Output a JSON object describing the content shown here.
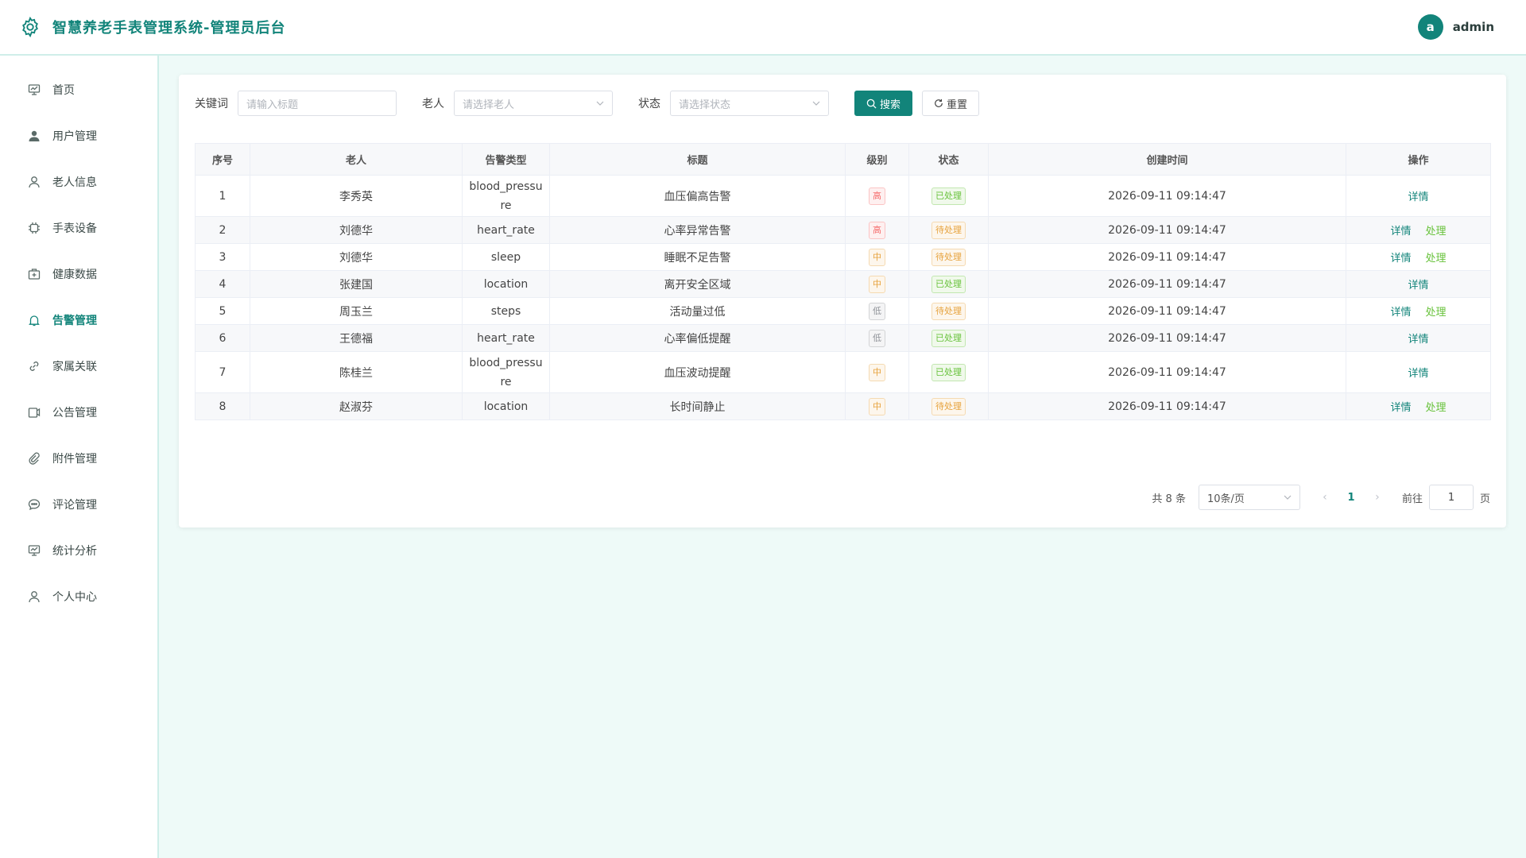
{
  "header": {
    "title": "智慧养老手表管理系统-管理员后台",
    "user": {
      "avatar_letter": "a",
      "name": "admin"
    }
  },
  "sidebar": {
    "items": [
      {
        "label": "首页",
        "icon": "dashboard-icon"
      },
      {
        "label": "用户管理",
        "icon": "user-filled-icon"
      },
      {
        "label": "老人信息",
        "icon": "user-icon"
      },
      {
        "label": "手表设备",
        "icon": "chip-icon"
      },
      {
        "label": "健康数据",
        "icon": "medical-box-icon"
      },
      {
        "label": "告警管理",
        "icon": "bell-icon",
        "active": true
      },
      {
        "label": "家属关联",
        "icon": "link-icon"
      },
      {
        "label": "公告管理",
        "icon": "notice-icon"
      },
      {
        "label": "附件管理",
        "icon": "paperclip-icon"
      },
      {
        "label": "评论管理",
        "icon": "chat-icon"
      },
      {
        "label": "统计分析",
        "icon": "chart-icon"
      },
      {
        "label": "个人中心",
        "icon": "user-icon"
      }
    ]
  },
  "filters": {
    "keyword_label": "关键词",
    "keyword_placeholder": "请输入标题",
    "elder_label": "老人",
    "elder_placeholder": "请选择老人",
    "status_label": "状态",
    "status_placeholder": "请选择状态",
    "search_button": "搜索",
    "reset_button": "重置"
  },
  "table": {
    "columns": [
      "序号",
      "老人",
      "告警类型",
      "标题",
      "级别",
      "状态",
      "创建时间",
      "操作"
    ],
    "rows": [
      {
        "index": "1",
        "elder": "李秀英",
        "type": "blood_pressure",
        "title": "血压偏高告警",
        "level": "高",
        "status": "已处理",
        "created": "2026-09-11 09:14:47"
      },
      {
        "index": "2",
        "elder": "刘德华",
        "type": "heart_rate",
        "title": "心率异常告警",
        "level": "高",
        "status": "待处理",
        "created": "2026-09-11 09:14:47"
      },
      {
        "index": "3",
        "elder": "刘德华",
        "type": "sleep",
        "title": "睡眠不足告警",
        "level": "中",
        "status": "待处理",
        "created": "2026-09-11 09:14:47"
      },
      {
        "index": "4",
        "elder": "张建国",
        "type": "location",
        "title": "离开安全区域",
        "level": "中",
        "status": "已处理",
        "created": "2026-09-11 09:14:47"
      },
      {
        "index": "5",
        "elder": "周玉兰",
        "type": "steps",
        "title": "活动量过低",
        "level": "低",
        "status": "待处理",
        "created": "2026-09-11 09:14:47"
      },
      {
        "index": "6",
        "elder": "王德福",
        "type": "heart_rate",
        "title": "心率偏低提醒",
        "level": "低",
        "status": "已处理",
        "created": "2026-09-11 09:14:47"
      },
      {
        "index": "7",
        "elder": "陈桂兰",
        "type": "blood_pressure",
        "title": "血压波动提醒",
        "level": "中",
        "status": "已处理",
        "created": "2026-09-11 09:14:47"
      },
      {
        "index": "8",
        "elder": "赵淑芬",
        "type": "location",
        "title": "长时间静止",
        "level": "中",
        "status": "待处理",
        "created": "2026-09-11 09:14:47"
      }
    ],
    "detail_label": "详情",
    "handle_label": "处理"
  },
  "pagination": {
    "total_text": "共 8 条",
    "page_size": "10条/页",
    "current_page": "1",
    "goto_label": "前往",
    "goto_value": "1",
    "page_suffix": "页"
  },
  "colors": {
    "primary": "#12847a",
    "level_high": "#f56c6c",
    "level_mid": "#e6a23c",
    "level_low": "#909399",
    "status_done": "#67c23a",
    "status_pending": "#e6a23c"
  }
}
